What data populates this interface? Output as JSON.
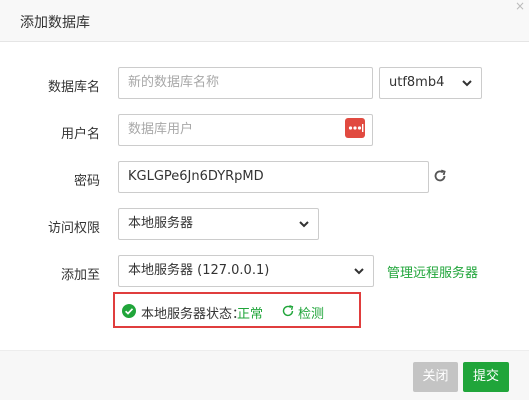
{
  "dialog": {
    "title": "添加数据库",
    "close_glyph": "×"
  },
  "form": {
    "db_name": {
      "label": "数据库名",
      "placeholder": "新的数据库名称",
      "charset_value": "utf8mb4"
    },
    "username": {
      "label": "用户名",
      "placeholder": "数据库用户",
      "generate_icon": "random-dots-icon"
    },
    "password": {
      "label": "密码",
      "value": "KGLGPe6Jn6DYRpMD",
      "refresh_icon": "refresh-icon"
    },
    "access": {
      "label": "访问权限",
      "value": "本地服务器"
    },
    "add_to": {
      "label": "添加至",
      "value": "本地服务器 (127.0.0.1)",
      "manage_link": "管理远程服务器"
    },
    "status": {
      "label": "本地服务器状态：",
      "value": "正常",
      "detect_label": "检测"
    }
  },
  "footer": {
    "close_label": "关闭",
    "submit_label": "提交"
  },
  "colors": {
    "accent_green": "#20a53a",
    "highlight_red": "#e03d3d",
    "generate_button_red": "#e14a40",
    "disabled_gray": "#c4c4c4"
  }
}
